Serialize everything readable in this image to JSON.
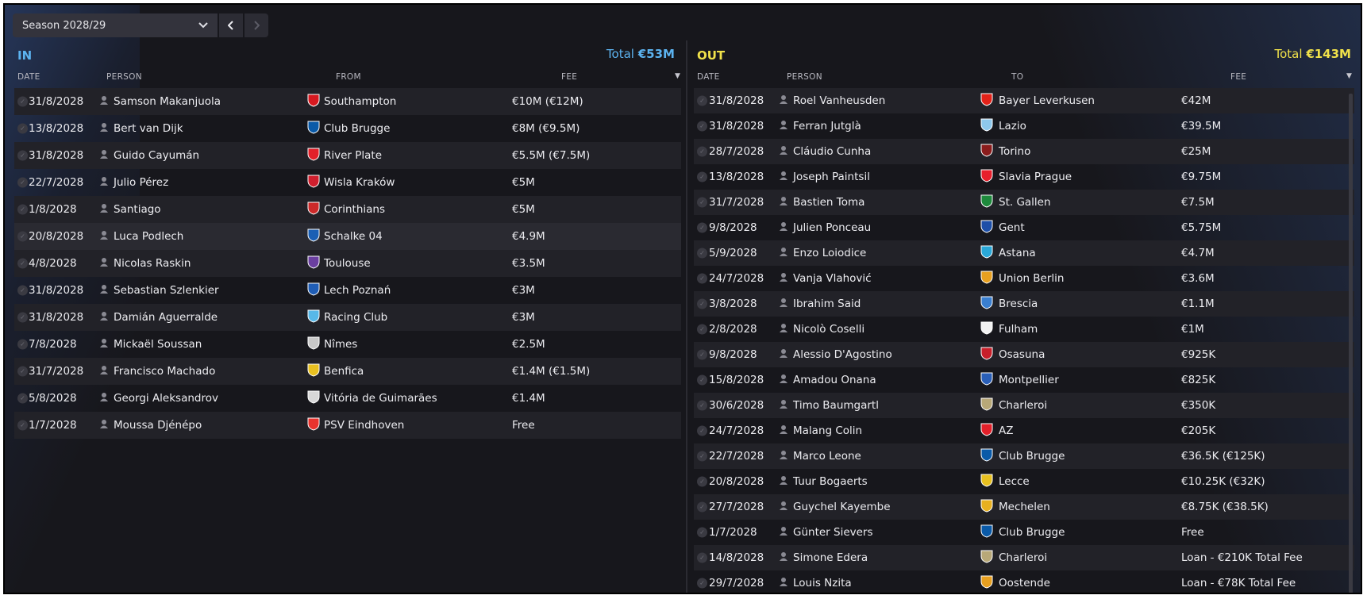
{
  "season": {
    "label": "Season 2028/29"
  },
  "in_panel": {
    "label": "IN",
    "total_prefix": "Total",
    "total_value": "€53M",
    "columns": {
      "date": "DATE",
      "person": "PERSON",
      "club": "FROM",
      "fee": "FEE"
    },
    "rows": [
      {
        "date": "31/8/2028",
        "person": "Samson Makanjuola",
        "club": "Southampton",
        "fee": "€10M (€12M)",
        "crest_color": "#d71920"
      },
      {
        "date": "13/8/2028",
        "person": "Bert van Dijk",
        "club": "Club Brugge",
        "fee": "€8M (€9.5M)",
        "crest_color": "#0a5aa8"
      },
      {
        "date": "31/8/2028",
        "person": "Guido Cayumán",
        "club": "River Plate",
        "fee": "€5.5M (€7.5M)",
        "crest_color": "#e2202a"
      },
      {
        "date": "22/7/2028",
        "person": "Julio Pérez",
        "club": "Wisla Kraków",
        "fee": "€5M",
        "crest_color": "#d01f2e"
      },
      {
        "date": "1/8/2028",
        "person": "Santiago",
        "club": "Corinthians",
        "fee": "€5M",
        "crest_color": "#cc2a2a"
      },
      {
        "date": "20/8/2028",
        "person": "Luca Podlech",
        "club": "Schalke 04",
        "fee": "€4.9M",
        "crest_color": "#1b5fb4"
      },
      {
        "date": "4/8/2028",
        "person": "Nicolas Raskin",
        "club": "Toulouse",
        "fee": "€3.5M",
        "crest_color": "#6b3fa0"
      },
      {
        "date": "31/8/2028",
        "person": "Sebastian Szlenkier",
        "club": "Lech Poznań",
        "fee": "€3M",
        "crest_color": "#1f5db5"
      },
      {
        "date": "31/8/2028",
        "person": "Damián Aguerralde",
        "club": "Racing Club",
        "fee": "€3M",
        "crest_color": "#58b8e8"
      },
      {
        "date": "7/8/2028",
        "person": "Mickaël Soussan",
        "club": "Nîmes",
        "fee": "€2.5M",
        "crest_color": "#c8c8c8"
      },
      {
        "date": "31/7/2028",
        "person": "Francisco Machado",
        "club": "Benfica",
        "fee": "€1.4M (€1.5M)",
        "crest_color": "#e8c020"
      },
      {
        "date": "5/8/2028",
        "person": "Georgi Aleksandrov",
        "club": "Vitória de Guimarães",
        "fee": "€1.4M",
        "crest_color": "#d8d8d8"
      },
      {
        "date": "1/7/2028",
        "person": "Moussa Djénépo",
        "club": "PSV Eindhoven",
        "fee": "Free",
        "crest_color": "#e8332e"
      }
    ]
  },
  "out_panel": {
    "label": "OUT",
    "total_prefix": "Total",
    "total_value": "€143M",
    "columns": {
      "date": "DATE",
      "person": "PERSON",
      "club": "TO",
      "fee": "FEE"
    },
    "rows": [
      {
        "date": "31/8/2028",
        "person": "Roel Vanheusden",
        "club": "Bayer Leverkusen",
        "fee": "€42M",
        "crest_color": "#e32219"
      },
      {
        "date": "31/8/2028",
        "person": "Ferran Jutglà",
        "club": "Lazio",
        "fee": "€39.5M",
        "crest_color": "#8ec8ec"
      },
      {
        "date": "28/7/2028",
        "person": "Cláudio Cunha",
        "club": "Torino",
        "fee": "€25M",
        "crest_color": "#8a1c1c"
      },
      {
        "date": "13/8/2028",
        "person": "Joseph Paintsil",
        "club": "Slavia Prague",
        "fee": "€9.75M",
        "crest_color": "#e81f2c"
      },
      {
        "date": "31/7/2028",
        "person": "Bastien Toma",
        "club": "St. Gallen",
        "fee": "€7.5M",
        "crest_color": "#1e8a3c"
      },
      {
        "date": "9/8/2028",
        "person": "Julien Ponceau",
        "club": "Gent",
        "fee": "€5.75M",
        "crest_color": "#1d4fa8"
      },
      {
        "date": "5/9/2028",
        "person": "Enzo Loiodice",
        "club": "Astana",
        "fee": "€4.7M",
        "crest_color": "#2aa8d8"
      },
      {
        "date": "24/7/2028",
        "person": "Vanja Vlahović",
        "club": "Union Berlin",
        "fee": "€3.6M",
        "crest_color": "#e8a020"
      },
      {
        "date": "3/8/2028",
        "person": "Ibrahim Said",
        "club": "Brescia",
        "fee": "€1.1M",
        "crest_color": "#3a7fd0"
      },
      {
        "date": "2/8/2028",
        "person": "Nicolò Coselli",
        "club": "Fulham",
        "fee": "€1M",
        "crest_color": "#f2f2f2"
      },
      {
        "date": "9/8/2028",
        "person": "Alessio D'Agostino",
        "club": "Osasuna",
        "fee": "€925K",
        "crest_color": "#c81f2a"
      },
      {
        "date": "15/8/2028",
        "person": "Amadou Onana",
        "club": "Montpellier",
        "fee": "€825K",
        "crest_color": "#2a5fb8"
      },
      {
        "date": "30/6/2028",
        "person": "Timo Baumgartl",
        "club": "Charleroi",
        "fee": "€350K",
        "crest_color": "#b8a878"
      },
      {
        "date": "24/7/2028",
        "person": "Malang Colin",
        "club": "AZ",
        "fee": "€205K",
        "crest_color": "#e2202a"
      },
      {
        "date": "22/7/2028",
        "person": "Marco Leone",
        "club": "Club Brugge",
        "fee": "€36.5K (€125K)",
        "crest_color": "#0a5aa8"
      },
      {
        "date": "20/8/2028",
        "person": "Tuur Bogaerts",
        "club": "Lecce",
        "fee": "€10.25K (€32K)",
        "crest_color": "#e8c020"
      },
      {
        "date": "27/7/2028",
        "person": "Guychel Kayembe",
        "club": "Mechelen",
        "fee": "€8.75K (€38.5K)",
        "crest_color": "#e8b020"
      },
      {
        "date": "1/7/2028",
        "person": "Günter Sievers",
        "club": "Club Brugge",
        "fee": "Free",
        "crest_color": "#0a5aa8"
      },
      {
        "date": "14/8/2028",
        "person": "Simone Edera",
        "club": "Charleroi",
        "fee": "Loan - €210K Total Fee",
        "crest_color": "#b8a878"
      },
      {
        "date": "29/7/2028",
        "person": "Louis Nzita",
        "club": "Oostende",
        "fee": "Loan - €78K Total Fee",
        "crest_color": "#e8a020"
      }
    ]
  }
}
